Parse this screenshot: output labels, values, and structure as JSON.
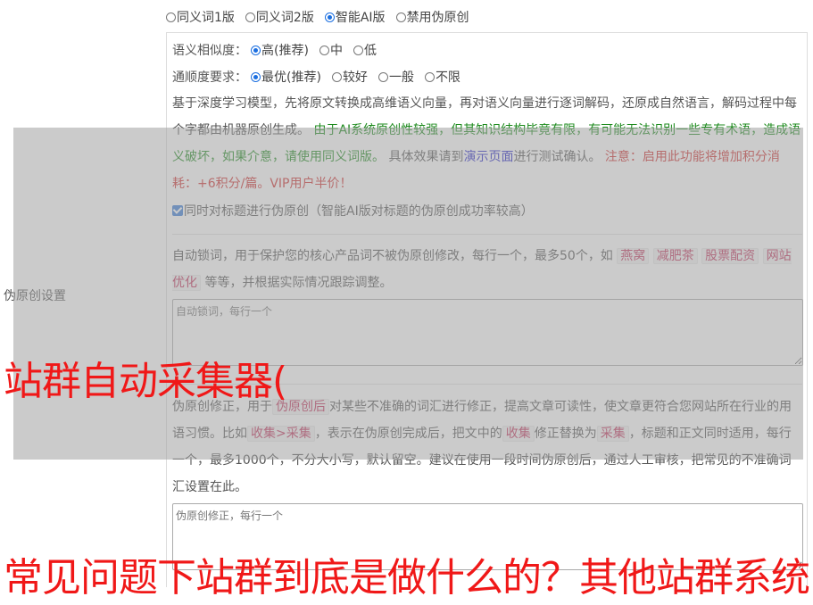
{
  "mode_options": [
    {
      "label": "同义词1版",
      "selected": false
    },
    {
      "label": "同义词2版",
      "selected": false
    },
    {
      "label": "智能AI版",
      "selected": true
    },
    {
      "label": "禁用伪原创",
      "selected": false
    }
  ],
  "side_label": "伪原创设置",
  "similarity": {
    "label": "语义相似度：",
    "options": [
      {
        "label": "高(推荐)",
        "selected": true
      },
      {
        "label": "中",
        "selected": false
      },
      {
        "label": "低",
        "selected": false
      }
    ]
  },
  "fluency": {
    "label": "通顺度要求：",
    "options": [
      {
        "label": "最优(推荐)",
        "selected": true
      },
      {
        "label": "较好",
        "selected": false
      },
      {
        "label": "一般",
        "selected": false
      },
      {
        "label": "不限",
        "selected": false
      }
    ]
  },
  "description": {
    "intro": "基于深度学习模型，先将原文转换成高维语义向量，再对语义向量进行逐词解码，还原成自然语言，解码过程中每个字都由机器原创生成。",
    "warning_green": "由于AI系统原创性较强，但其知识结构毕竟有限，有可能无法识别一些专有术语，造成语义破坏，如果介意，请使用同义词版。",
    "test_prefix": "具体效果请到",
    "test_link": "演示页面",
    "test_suffix": "进行测试确认。",
    "notice_red": "注意：启用此功能将增加积分消耗：+6积分/篇。VIP用户半价！"
  },
  "title_checkbox": {
    "label": "同时对标题进行伪原创（智能AI版对标题的伪原创成功率较高）",
    "checked": true
  },
  "lock_words": {
    "desc_before": "自动锁词，用于保护您的核心产品词不被伪原创修改，每行一个，最多50个，如",
    "tags": [
      "燕窝",
      "减肥茶",
      "股票配资",
      "网站优化"
    ],
    "desc_after": "等等，并根据实际情况跟踪调整。",
    "placeholder": "自动锁词，每行一个"
  },
  "corrections": {
    "p1": "伪原创修正，用于",
    "tag1": "伪原创后",
    "p2": "对某些不准确的词汇进行修正，提高文章可读性，使文章更符合您网站所在行业的用语习惯。比如",
    "tag2": "收集>采集",
    "p3": "，表示在伪原创完成后，把文中的",
    "tag3": "收集",
    "p4": "修正替换为",
    "tag4": "采集",
    "p5": "，标题和正文同时适用，每行一个，最多1000个，不分大小写，默认留空。建议在使用一段时间伪原创后，通过人工审核，把常见的不准确词汇设置在此。",
    "placeholder": "伪原创修正，每行一个"
  },
  "watermark": {
    "line1": "站群自动采集器(",
    "line2": "常见问题下站群到底是做什么的？其他站群系统"
  },
  "colors": {
    "accent": "#1a6ee0",
    "green": "#1c8a1c",
    "red": "#d03030",
    "link": "#2323c8"
  }
}
